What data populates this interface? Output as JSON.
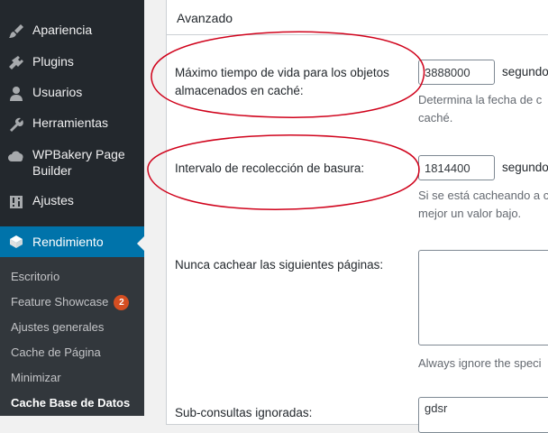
{
  "sidebar": {
    "items": [
      {
        "label": "Apariencia",
        "icon": "brush-icon"
      },
      {
        "label": "Plugins",
        "icon": "plugin-icon"
      },
      {
        "label": "Usuarios",
        "icon": "user-icon"
      },
      {
        "label": "Herramientas",
        "icon": "wrench-icon"
      },
      {
        "label": "WPBakery Page Builder",
        "line1": "WPBakery Page",
        "line2": "Builder",
        "icon": "cloud-icon"
      },
      {
        "label": "Ajustes",
        "icon": "settings-icon"
      }
    ],
    "active": {
      "label": "Rendimiento",
      "icon": "performance-icon"
    },
    "submenu": [
      {
        "label": "Escritorio"
      },
      {
        "label": "Feature Showcase",
        "badge": "2"
      },
      {
        "label": "Ajustes generales"
      },
      {
        "label": "Cache de Página"
      },
      {
        "label": "Minimizar"
      },
      {
        "label": "Cache Base de Datos"
      }
    ],
    "colors": {
      "background": "#23282d",
      "active": "#0073aa",
      "submenu": "#32373c",
      "badge": "#d54e21"
    }
  },
  "panel": {
    "title": "Avanzado",
    "rows": [
      {
        "label": "Máximo tiempo de vida para los objetos almacenados en caché:",
        "value": "3888000",
        "unit": "segundo",
        "desc_line1": "Determina la fecha de c",
        "desc_line2": "caché."
      },
      {
        "label": "Intervalo de recolección de basura:",
        "value": "1814400",
        "unit": "segundo",
        "desc_line1": "Si se está cacheando a c",
        "desc_line2": "mejor un valor bajo."
      },
      {
        "label": "Nunca cachear las siguientes páginas:",
        "value": "",
        "desc_line1": "Always ignore the speci"
      },
      {
        "label": "Sub-consultas ignoradas:",
        "value": "gdsr"
      }
    ]
  },
  "annotation_color": "#d0021b"
}
